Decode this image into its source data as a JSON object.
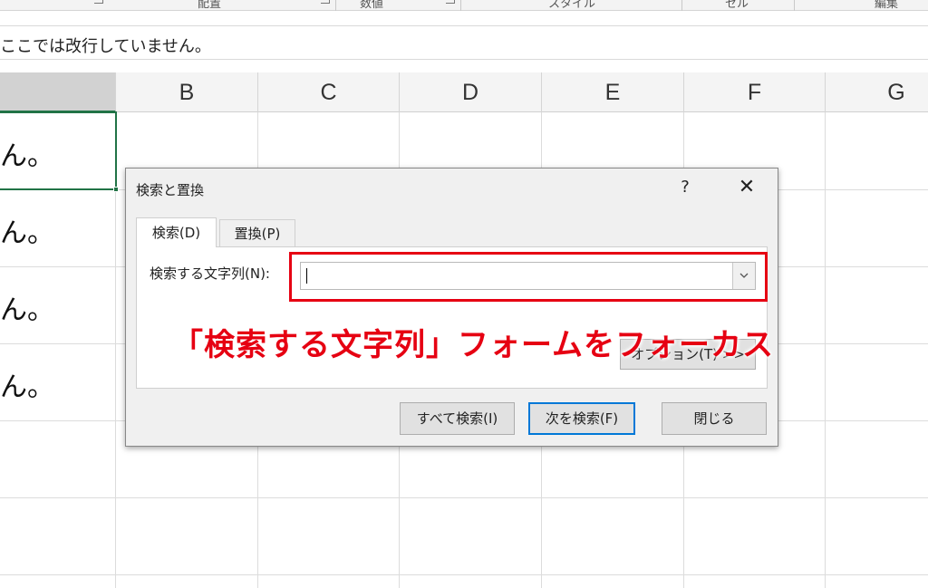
{
  "ribbon": {
    "groups": [
      "配置",
      "数値",
      "スタイル",
      "セル",
      "編集"
    ]
  },
  "formula_bar": {
    "text": "ここでは改行していません。"
  },
  "columns": [
    "B",
    "C",
    "D",
    "E",
    "F",
    "G"
  ],
  "cells": {
    "a_values": [
      "ん。",
      "ん。",
      "ん。",
      "ん。"
    ]
  },
  "dialog": {
    "title": "検索と置換",
    "help_glyph": "?",
    "close_glyph": "✕",
    "tabs": [
      {
        "label": "検索(D)",
        "selected": true
      },
      {
        "label": "置換(P)",
        "selected": false
      }
    ],
    "find_label": "検索する文字列(N):",
    "find_value": "",
    "options_label": "オプション(T) >>",
    "buttons": {
      "find_all": "すべて検索(I)",
      "find_next": "次を検索(F)",
      "close": "閉じる"
    }
  },
  "annotation": {
    "text": "「検索する文字列」フォームをフォーカス",
    "color": "#e60012"
  },
  "colors": {
    "accent": "#217346",
    "highlight": "#e60012",
    "default_button_border": "#0078d7"
  }
}
